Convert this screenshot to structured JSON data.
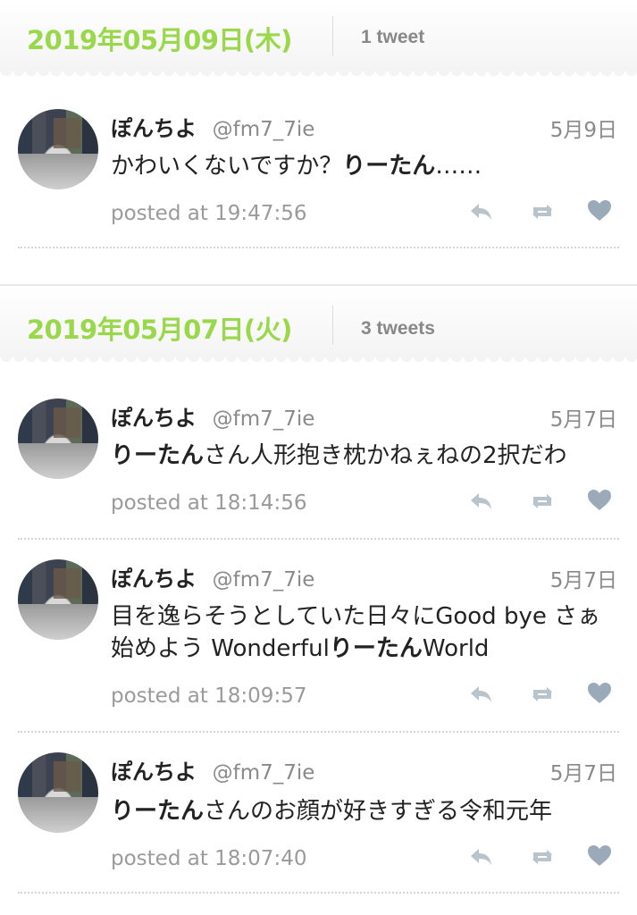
{
  "days": [
    {
      "date": "2019年05月09日(木)",
      "count": "1 tweet",
      "tweets": [
        {
          "name": "ぽんちよ",
          "handle": "@fm7_7ie",
          "date": "5月9日",
          "text_parts": [
            "かわいくないですか？",
            "りーたん",
            "……"
          ],
          "posted": "posted at 19:47:56"
        }
      ]
    },
    {
      "date": "2019年05月07日(火)",
      "count": "3 tweets",
      "tweets": [
        {
          "name": "ぽんちよ",
          "handle": "@fm7_7ie",
          "date": "5月7日",
          "text_parts": [
            "",
            "りーたん",
            "さん人形抱き枕かねぇねの2択だわ"
          ],
          "posted": "posted at 18:14:56"
        },
        {
          "name": "ぽんちよ",
          "handle": "@fm7_7ie",
          "date": "5月7日",
          "text_parts": [
            "目を逸らそうとしていた日々にGood bye さぁ始めよう Wonderful",
            "りーたん",
            "World"
          ],
          "posted": "posted at 18:09:57"
        },
        {
          "name": "ぽんちよ",
          "handle": "@fm7_7ie",
          "date": "5月7日",
          "text_parts": [
            "",
            "りーたん",
            "さんのお顔が好きすぎる令和元年"
          ],
          "posted": "posted at 18:07:40"
        }
      ]
    }
  ],
  "icons": {
    "reply": "reply-icon",
    "retweet": "retweet-icon",
    "like": "heart-icon"
  },
  "colors": {
    "date_green": "#99d84a",
    "icon_gray": "#b8c3cc",
    "heart": "#9aaab8"
  }
}
